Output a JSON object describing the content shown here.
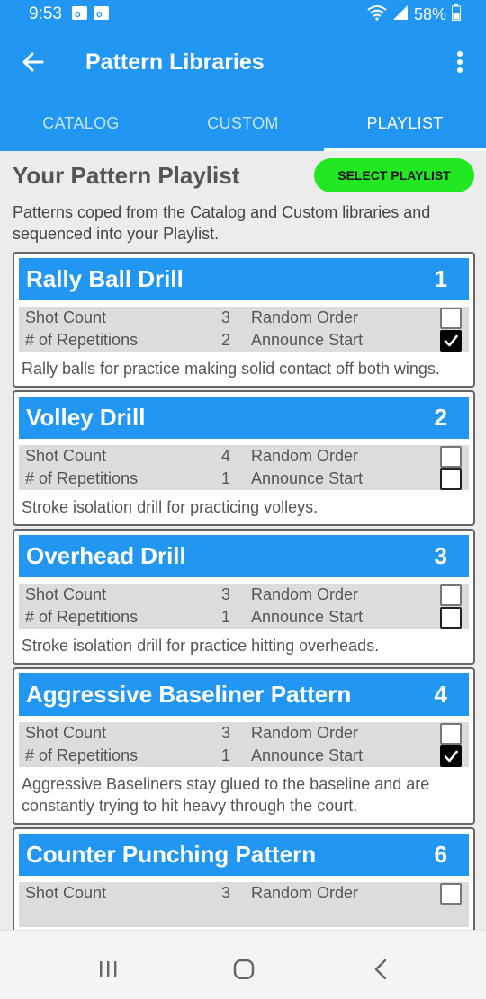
{
  "status_bar": {
    "time": "9:53",
    "battery_text": "58%",
    "icons": [
      "outlook-icon",
      "outlook-icon",
      "wifi-icon",
      "signal-icon",
      "battery-icon"
    ]
  },
  "app_bar": {
    "title": "Pattern Libraries",
    "back_icon": "arrow-left-icon",
    "menu_icon": "more-vert-icon"
  },
  "tabs": [
    {
      "label": "CATALOG",
      "active": false
    },
    {
      "label": "CUSTOM",
      "active": false
    },
    {
      "label": "PLAYLIST",
      "active": true
    }
  ],
  "playlist": {
    "heading": "Your Pattern Playlist",
    "select_button": "SELECT PLAYLIST",
    "description": "Patterns coped from the Catalog and Custom libraries and sequenced into your Playlist."
  },
  "labels": {
    "shot_count": "Shot Count",
    "repetitions": "# of Repetitions",
    "random_order": "Random Order",
    "announce_start": "Announce Start"
  },
  "patterns": [
    {
      "name": "Rally Ball Drill",
      "number": "1",
      "shot_count": "3",
      "repetitions": "2",
      "random_order": false,
      "announce_start": true,
      "description": "Rally balls for practice making solid contact off both wings."
    },
    {
      "name": "Volley Drill",
      "number": "2",
      "shot_count": "4",
      "repetitions": "1",
      "random_order": false,
      "announce_start": false,
      "description": "Stroke isolation drill for practicing volleys."
    },
    {
      "name": "Overhead Drill",
      "number": "3",
      "shot_count": "3",
      "repetitions": "1",
      "random_order": false,
      "announce_start": false,
      "description": "Stroke isolation drill for practice hitting overheads."
    },
    {
      "name": "Aggressive Baseliner Pattern",
      "number": "4",
      "shot_count": "3",
      "repetitions": "1",
      "random_order": false,
      "announce_start": true,
      "description": "Aggressive Baseliners stay glued to the baseline and are constantly trying to hit heavy through the court."
    },
    {
      "name": "Counter Punching Pattern",
      "number": "6",
      "shot_count": "3",
      "repetitions": "",
      "random_order": false,
      "announce_start": false,
      "description": ""
    }
  ],
  "colors": {
    "primary": "#2196f3",
    "select_button": "#22e822",
    "content_bg": "#ececec"
  },
  "nav_bar": {
    "icons": [
      "recent-apps-icon",
      "home-icon",
      "back-icon"
    ]
  }
}
